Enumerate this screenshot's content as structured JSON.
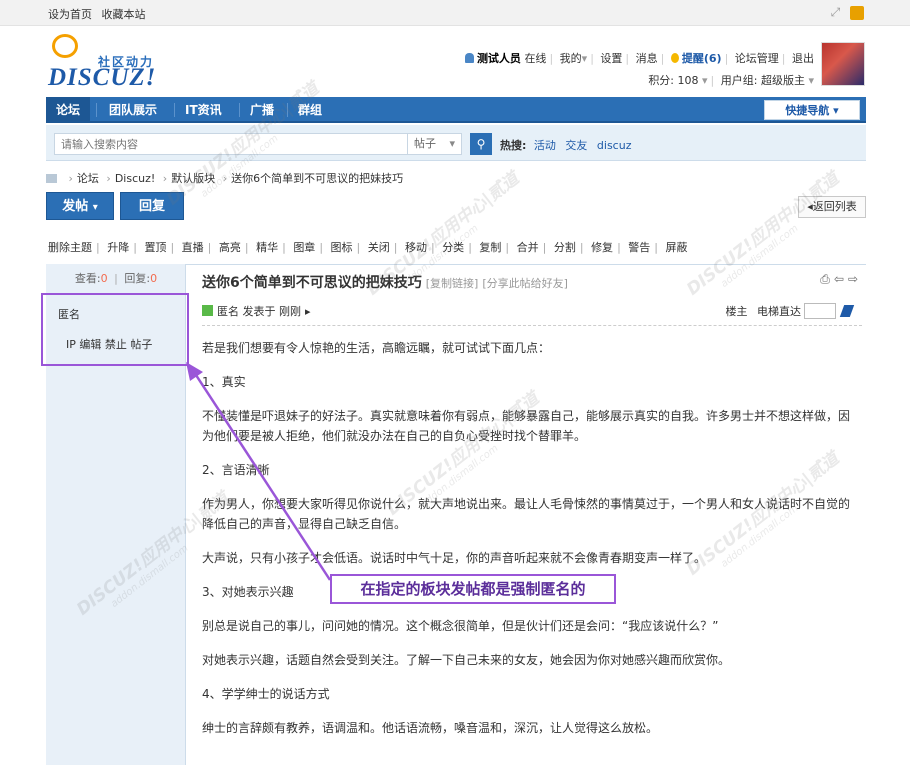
{
  "topbar": {
    "set_home": "设为首页",
    "bookmark": "收藏本站"
  },
  "logo": {
    "subtitle": "社区动力",
    "name": "DISCUZ!"
  },
  "user": {
    "username": "测试人员",
    "status": "在线",
    "menu_mine": "我的",
    "settings": "设置",
    "messages": "消息",
    "remind": "提醒(6)",
    "admin": "论坛管理",
    "logout": "退出",
    "points": "积分: 108",
    "group": "用户组: 超级版主"
  },
  "nav": {
    "items": [
      "论坛",
      "团队展示",
      "IT资讯",
      "广播",
      "群组"
    ],
    "quick_nav": "快捷导航"
  },
  "search": {
    "placeholder": "请输入搜索内容",
    "type": "帖子",
    "hot_label": "热搜:",
    "hot_tags": [
      "活动",
      "交友",
      "discuz"
    ]
  },
  "breadcrumb": [
    "论坛",
    "Discuz!",
    "默认版块",
    "送你6个简单到不可思议的把妹技巧"
  ],
  "actions": {
    "post": "发帖",
    "reply": "回复",
    "back_to_list": "返回列表"
  },
  "modbar": [
    "删除主题",
    "升降",
    "置顶",
    "直播",
    "高亮",
    "精华",
    "图章",
    "图标",
    "关闭",
    "移动",
    "分类",
    "复制",
    "合并",
    "分割",
    "修复",
    "警告",
    "屏蔽"
  ],
  "stats": {
    "views_label": "查看:",
    "views": "0",
    "replies_label": "回复:",
    "replies": "0"
  },
  "author": {
    "name": "匿名",
    "actions": "IP 编辑 禁止 帖子"
  },
  "post": {
    "title": "送你6个简单到不可思议的把妹技巧",
    "copy_link": "[复制链接]",
    "share": "[分享此帖给好友]",
    "author": "匿名",
    "posted": "发表于 刚刚",
    "floor_owner": "楼主",
    "floor_jump": "电梯直达",
    "paragraphs": [
      "若是我们想要有令人惊艳的生活，高瞻远瞩，就可试试下面几点：",
      "1、真实",
      "不懂装懂是吓退妹子的好法子。真实就意味着你有弱点，能够暴露自己，能够展示真实的自我。许多男士并不想这样做，因为他们要是被人拒绝，他们就没办法在自己的自负心受挫时找个替罪羊。",
      "2、言语清晰",
      "作为男人，你想要大家听得见你说什么，就大声地说出来。最让人毛骨悚然的事情莫过于，一个男人和女人说话时不自觉的降低自己的声音，显得自己缺乏自信。",
      "大声说，只有小孩子才会低语。说话时中气十足，你的声音听起来就不会像青春期变声一样了。",
      "3、对她表示兴趣",
      "别总是说自己的事儿，问问她的情况。这个概念很简单，但是伙计们还是会问：“我应该说什么？”",
      "对她表示兴趣，话题自然会受到关注。了解一下自己未来的女友，她会因为你对她感兴趣而欣赏你。",
      "4、学学绅士的说话方式",
      "绅士的言辞颇有教养，语调温和。他话语流畅，嗓音温和，深沉，让人觉得这么放松。"
    ]
  },
  "annotation": {
    "text": "在指定的板块发帖都是强制匿名的",
    "color": "#9a56d8"
  },
  "watermark": {
    "brand": "DISCUZ!应用中心|贰道",
    "domain": "addon.dismall.com"
  }
}
